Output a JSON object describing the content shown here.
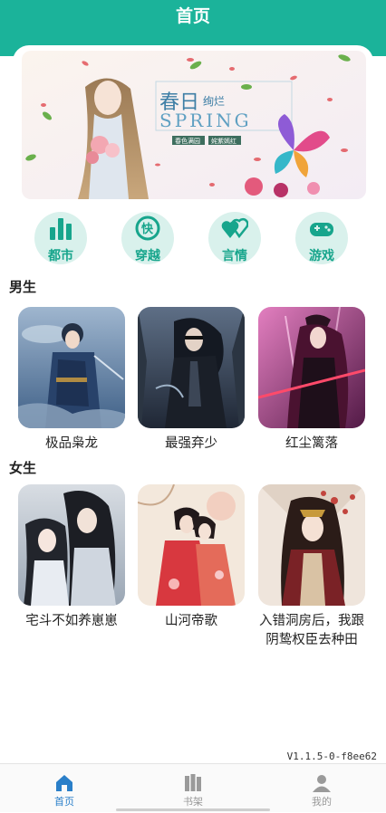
{
  "header": {
    "title": "首页"
  },
  "banner": {
    "headline": "春日",
    "headline_small": "绚烂",
    "subtitle": "SPRING",
    "tag_left": "春色满园",
    "tag_right": "姹紫嫣红"
  },
  "categories": [
    {
      "label": "都市",
      "icon": "bar-chart-icon"
    },
    {
      "label": "穿越",
      "icon": "time-travel-icon"
    },
    {
      "label": "言情",
      "icon": "hearts-icon"
    },
    {
      "label": "游戏",
      "icon": "gamepad-icon"
    }
  ],
  "sections": [
    {
      "title": "男生",
      "books": [
        {
          "title": "极品枭龙"
        },
        {
          "title": "最强弃少"
        },
        {
          "title": "红尘篱落"
        }
      ]
    },
    {
      "title": "女生",
      "books": [
        {
          "title": "宅斗不如养崽崽"
        },
        {
          "title": "山河帝歌"
        },
        {
          "title": "入错洞房后，我跟阴鸷权臣去种田"
        }
      ]
    }
  ],
  "version": "V1.1.5-0-f8ee62",
  "tabbar": [
    {
      "label": "首页",
      "icon": "home-icon",
      "active": true
    },
    {
      "label": "书架",
      "icon": "bookshelf-icon",
      "active": false
    },
    {
      "label": "我的",
      "icon": "user-icon",
      "active": false
    }
  ],
  "colors": {
    "primary": "#1bb39a",
    "tab_active": "#2a7fc9",
    "category_bg": "#d9f1ec"
  }
}
